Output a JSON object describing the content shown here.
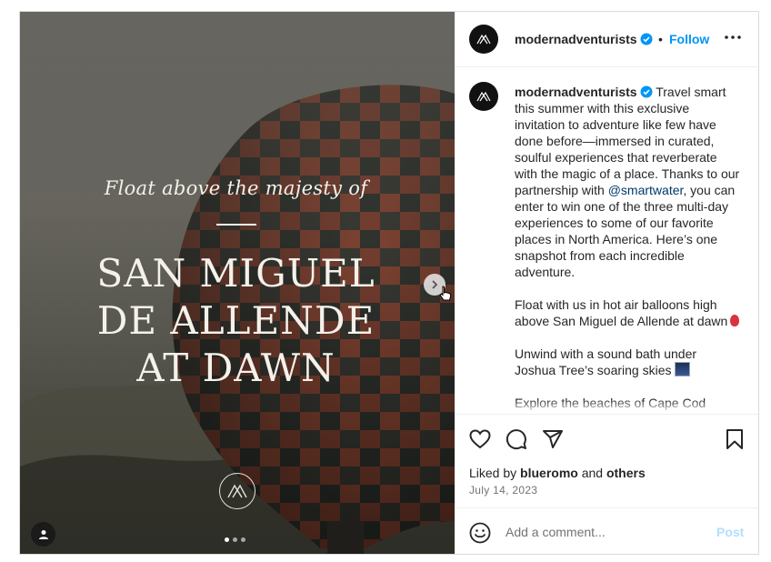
{
  "media": {
    "tagline": "Float above the majesty of",
    "headline_lines": [
      "SAN MIGUEL",
      "DE ALLENDE",
      "AT DAWN"
    ],
    "carousel_count": 3,
    "carousel_active_index": 0
  },
  "header": {
    "username": "modernadventurists",
    "separator": "•",
    "follow_label": "Follow"
  },
  "caption": {
    "username": "modernadventurists",
    "text_part1": " Travel smart this summer with this exclusive invitation to adventure like few have done before—immersed in curated, soulful experiences that reverberate with the magic of a place. Thanks to our partnership with ",
    "mention": "@smartwater",
    "text_part2": ", you can enter to win one of the three multi-day experiences to some of our favorite places in North America. Here’s one snapshot from each incredible adventure.\n\nFloat with us in hot air balloons high above San Miguel de Allende at dawn",
    "text_part3": "\n\nUnwind with a sound bath under Joshua Tree’s soaring skies",
    "text_part4": "\n\nExplore the beaches of Cape Cod"
  },
  "engagement": {
    "liked_prefix": "Liked by ",
    "liked_user": "blueromo",
    "liked_and": " and ",
    "liked_others": "others",
    "date": "July 14, 2023"
  },
  "comment": {
    "placeholder": "Add a comment...",
    "post_label": "Post"
  },
  "colors": {
    "accent": "#0095f6",
    "verified": "#0095f6",
    "post_disabled": "#b2dffc"
  }
}
